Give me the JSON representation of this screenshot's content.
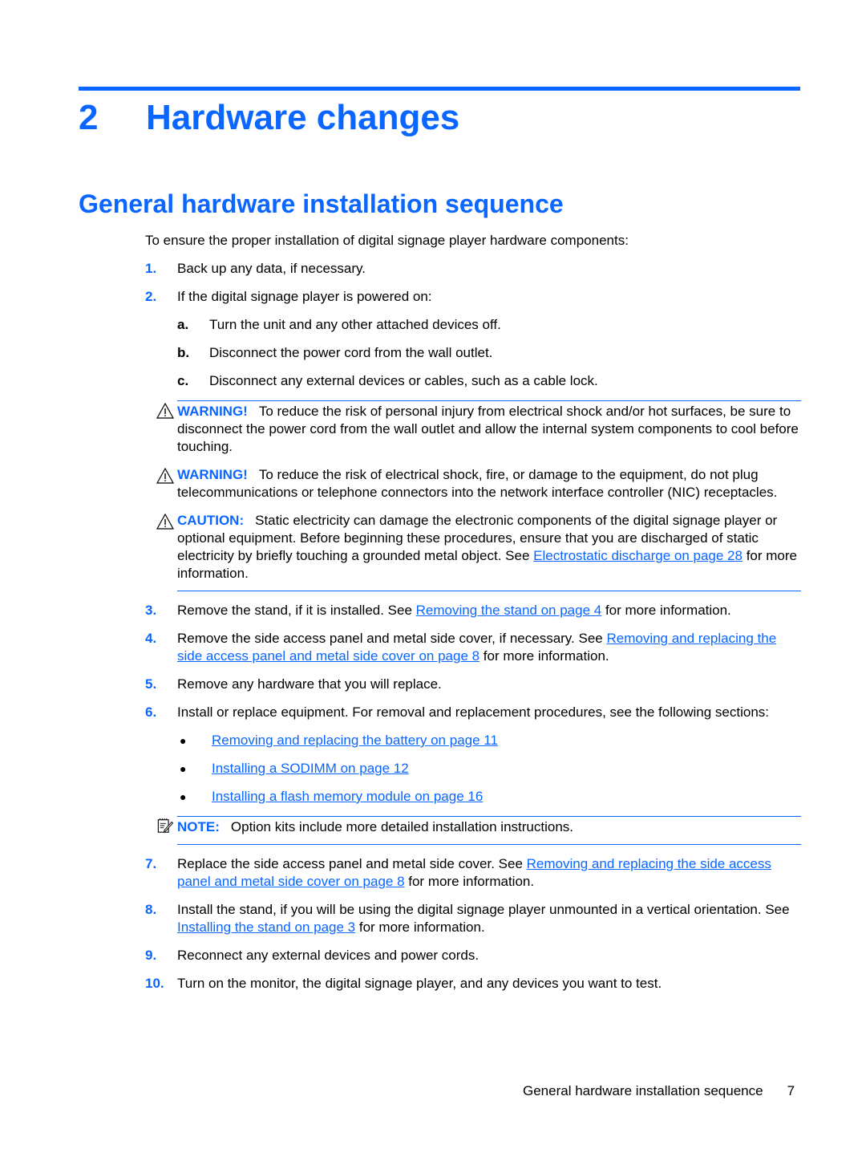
{
  "chapter": {
    "number": "2",
    "title": "Hardware changes"
  },
  "section": {
    "title": "General hardware installation sequence"
  },
  "intro": "To ensure the proper installation of digital signage player hardware components:",
  "steps": [
    {
      "num": "1.",
      "text": "Back up any data, if necessary."
    },
    {
      "num": "2.",
      "text": "If the digital signage player is powered on:",
      "substeps": [
        {
          "num": "a.",
          "text": "Turn the unit and any other attached devices off."
        },
        {
          "num": "b.",
          "text": "Disconnect the power cord from the wall outlet."
        },
        {
          "num": "c.",
          "text": "Disconnect any external devices or cables, such as a cable lock."
        }
      ]
    },
    {
      "num": "3.",
      "text_before": "Remove the stand, if it is installed. See ",
      "link": "Removing the stand on page 4",
      "text_after": " for more information."
    },
    {
      "num": "4.",
      "text_before": "Remove the side access panel and metal side cover, if necessary. See ",
      "link": "Removing and replacing the side access panel and metal side cover on page 8",
      "text_after": " for more information."
    },
    {
      "num": "5.",
      "text": "Remove any hardware that you will replace."
    },
    {
      "num": "6.",
      "text": "Install or replace equipment. For removal and replacement procedures, see the following sections:",
      "bullets": [
        {
          "icon": "bullet-dot",
          "link": "Removing and replacing the battery on page 11"
        },
        {
          "icon": "bullet-dot",
          "link": "Installing a SODIMM on page 12"
        },
        {
          "icon": "bullet-dot",
          "link": "Installing a flash memory module on page 16"
        }
      ]
    },
    {
      "num": "7.",
      "text_before": "Replace the side access panel and metal side cover. See ",
      "link": "Removing and replacing the side access panel and metal side cover on page 8",
      "text_after": " for more information."
    },
    {
      "num": "8.",
      "text_before": "Install the stand, if you will be using the digital signage player unmounted in a vertical orientation. See ",
      "link": "Installing the stand on page 3",
      "text_after": " for more information."
    },
    {
      "num": "9.",
      "text": "Reconnect any external devices and power cords."
    },
    {
      "num": "10.",
      "text": "Turn on the monitor, the digital signage player, and any devices you want to test."
    }
  ],
  "notices": {
    "warning1": {
      "icon": "warning-triangle",
      "label": "WARNING!",
      "text": "To reduce the risk of personal injury from electrical shock and/or hot surfaces, be sure to disconnect the power cord from the wall outlet and allow the internal system components to cool before touching."
    },
    "warning2": {
      "icon": "warning-triangle",
      "label": "WARNING!",
      "text": "To reduce the risk of electrical shock, fire, or damage to the equipment, do not plug telecommunications or telephone connectors into the network interface controller (NIC) receptacles."
    },
    "caution": {
      "icon": "warning-triangle",
      "label": "CAUTION:",
      "text_before": "Static electricity can damage the electronic components of the digital signage player or optional equipment. Before beginning these procedures, ensure that you are discharged of static electricity by briefly touching a grounded metal object. See ",
      "link": "Electrostatic discharge on page 28",
      "text_after": " for more information."
    },
    "note": {
      "icon": "note-pencil",
      "label": "NOTE:",
      "text": "Option kits include more detailed installation instructions."
    }
  },
  "footer": {
    "section": "General hardware installation sequence",
    "page": "7"
  },
  "colors": {
    "accent": "#0a66ff",
    "text": "#000000"
  }
}
